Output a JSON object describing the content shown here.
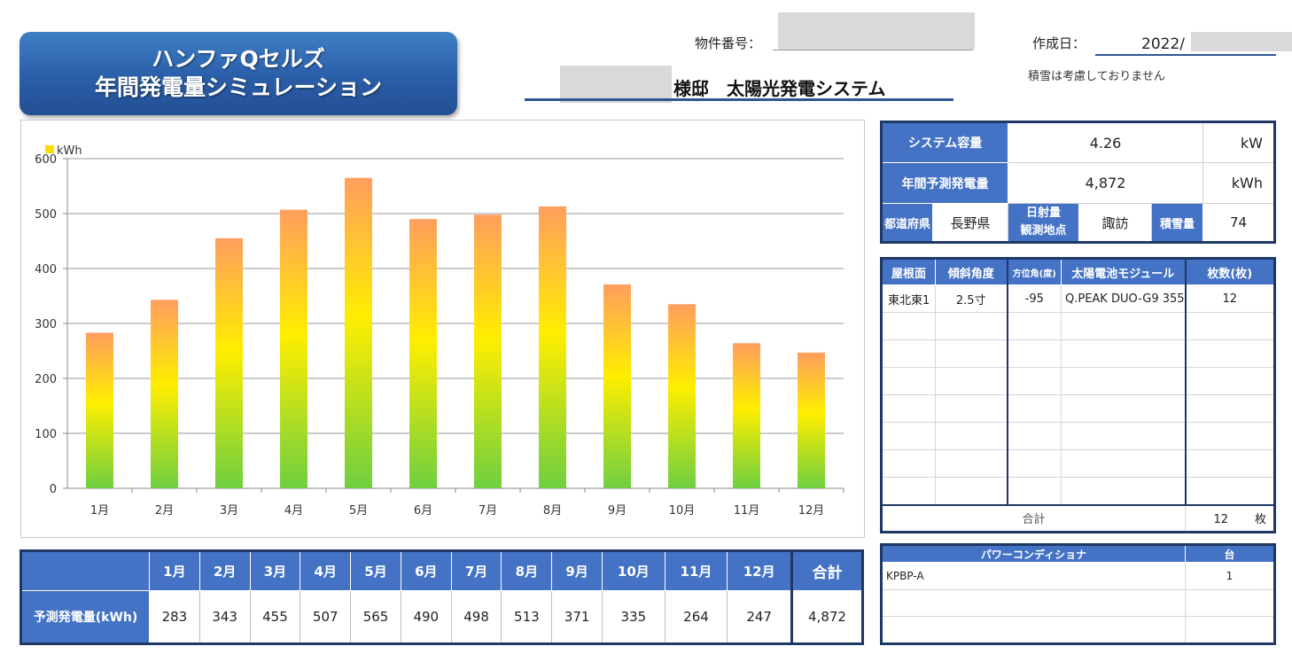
{
  "header": {
    "title_line1": "ハンファQセルズ",
    "title_line2": "年間発電量シミュレーション",
    "property_no_label": "物件番号：",
    "created_label": "作成日：",
    "created_value": "2022/",
    "owner_suffix": "様邸　太陽光発電システム",
    "note": "積雪は考慮しておりません"
  },
  "summary": {
    "capacity_label": "システム容量",
    "capacity_value": "4.26",
    "capacity_unit": "kW",
    "annual_label": "年間予測発電量",
    "annual_value": "4,872",
    "annual_unit": "kWh",
    "pref_label": "都道府県",
    "pref_value": "長野県",
    "irr_label_1": "日射量",
    "irr_label_2": "観測地点",
    "irr_value": "諏訪",
    "snow_label": "積雪量",
    "snow_value": "74"
  },
  "roof": {
    "headers": [
      "屋根面",
      "傾斜角度",
      "方位角(度)",
      "太陽電池モジュール",
      "枚数(枚)"
    ],
    "rows": [
      {
        "face": "東北東1",
        "angle": "2.5寸",
        "azimuth": "-95",
        "module": "Q.PEAK DUO-G9 355",
        "count": "12"
      }
    ],
    "total_label": "合計",
    "total_value": "12",
    "total_unit": "枚"
  },
  "pcs": {
    "headers": [
      "パワーコンディショナ",
      "台"
    ],
    "rows": [
      {
        "name": "KPBP-A",
        "count": "1"
      }
    ]
  },
  "month_table": {
    "row_label": "予測発電量(kWh)",
    "months": [
      "1月",
      "2月",
      "3月",
      "4月",
      "5月",
      "6月",
      "7月",
      "8月",
      "9月",
      "10月",
      "11月",
      "12月"
    ],
    "values": [
      "283",
      "343",
      "455",
      "507",
      "565",
      "490",
      "498",
      "513",
      "371",
      "335",
      "264",
      "247"
    ],
    "total_label": "合計",
    "total_value": "4,872"
  },
  "chart_data": {
    "type": "bar",
    "categories": [
      "1月",
      "2月",
      "3月",
      "4月",
      "5月",
      "6月",
      "7月",
      "8月",
      "9月",
      "10月",
      "11月",
      "12月"
    ],
    "series": [
      {
        "name": "kWh",
        "values": [
          283,
          343,
          455,
          507,
          565,
          490,
          498,
          513,
          371,
          335,
          264,
          247
        ]
      }
    ],
    "ylim": [
      0,
      600
    ],
    "yticks": [
      0,
      100,
      200,
      300,
      400,
      500,
      600
    ],
    "grid": true,
    "legend": "top-left",
    "colors": {
      "top": "#ff9e5e",
      "middle": "#ffee00",
      "bottom": "#6fcf40"
    }
  }
}
